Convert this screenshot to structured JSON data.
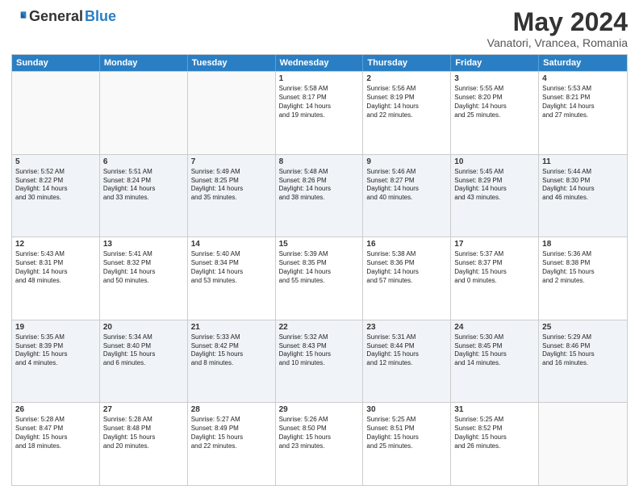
{
  "header": {
    "logo_general": "General",
    "logo_blue": "Blue",
    "month_title": "May 2024",
    "location": "Vanatori, Vrancea, Romania"
  },
  "days_of_week": [
    "Sunday",
    "Monday",
    "Tuesday",
    "Wednesday",
    "Thursday",
    "Friday",
    "Saturday"
  ],
  "rows": [
    {
      "alt": false,
      "cells": [
        {
          "day": "",
          "info": ""
        },
        {
          "day": "",
          "info": ""
        },
        {
          "day": "",
          "info": ""
        },
        {
          "day": "1",
          "info": "Sunrise: 5:58 AM\nSunset: 8:17 PM\nDaylight: 14 hours\nand 19 minutes."
        },
        {
          "day": "2",
          "info": "Sunrise: 5:56 AM\nSunset: 8:19 PM\nDaylight: 14 hours\nand 22 minutes."
        },
        {
          "day": "3",
          "info": "Sunrise: 5:55 AM\nSunset: 8:20 PM\nDaylight: 14 hours\nand 25 minutes."
        },
        {
          "day": "4",
          "info": "Sunrise: 5:53 AM\nSunset: 8:21 PM\nDaylight: 14 hours\nand 27 minutes."
        }
      ]
    },
    {
      "alt": true,
      "cells": [
        {
          "day": "5",
          "info": "Sunrise: 5:52 AM\nSunset: 8:22 PM\nDaylight: 14 hours\nand 30 minutes."
        },
        {
          "day": "6",
          "info": "Sunrise: 5:51 AM\nSunset: 8:24 PM\nDaylight: 14 hours\nand 33 minutes."
        },
        {
          "day": "7",
          "info": "Sunrise: 5:49 AM\nSunset: 8:25 PM\nDaylight: 14 hours\nand 35 minutes."
        },
        {
          "day": "8",
          "info": "Sunrise: 5:48 AM\nSunset: 8:26 PM\nDaylight: 14 hours\nand 38 minutes."
        },
        {
          "day": "9",
          "info": "Sunrise: 5:46 AM\nSunset: 8:27 PM\nDaylight: 14 hours\nand 40 minutes."
        },
        {
          "day": "10",
          "info": "Sunrise: 5:45 AM\nSunset: 8:29 PM\nDaylight: 14 hours\nand 43 minutes."
        },
        {
          "day": "11",
          "info": "Sunrise: 5:44 AM\nSunset: 8:30 PM\nDaylight: 14 hours\nand 46 minutes."
        }
      ]
    },
    {
      "alt": false,
      "cells": [
        {
          "day": "12",
          "info": "Sunrise: 5:43 AM\nSunset: 8:31 PM\nDaylight: 14 hours\nand 48 minutes."
        },
        {
          "day": "13",
          "info": "Sunrise: 5:41 AM\nSunset: 8:32 PM\nDaylight: 14 hours\nand 50 minutes."
        },
        {
          "day": "14",
          "info": "Sunrise: 5:40 AM\nSunset: 8:34 PM\nDaylight: 14 hours\nand 53 minutes."
        },
        {
          "day": "15",
          "info": "Sunrise: 5:39 AM\nSunset: 8:35 PM\nDaylight: 14 hours\nand 55 minutes."
        },
        {
          "day": "16",
          "info": "Sunrise: 5:38 AM\nSunset: 8:36 PM\nDaylight: 14 hours\nand 57 minutes."
        },
        {
          "day": "17",
          "info": "Sunrise: 5:37 AM\nSunset: 8:37 PM\nDaylight: 15 hours\nand 0 minutes."
        },
        {
          "day": "18",
          "info": "Sunrise: 5:36 AM\nSunset: 8:38 PM\nDaylight: 15 hours\nand 2 minutes."
        }
      ]
    },
    {
      "alt": true,
      "cells": [
        {
          "day": "19",
          "info": "Sunrise: 5:35 AM\nSunset: 8:39 PM\nDaylight: 15 hours\nand 4 minutes."
        },
        {
          "day": "20",
          "info": "Sunrise: 5:34 AM\nSunset: 8:40 PM\nDaylight: 15 hours\nand 6 minutes."
        },
        {
          "day": "21",
          "info": "Sunrise: 5:33 AM\nSunset: 8:42 PM\nDaylight: 15 hours\nand 8 minutes."
        },
        {
          "day": "22",
          "info": "Sunrise: 5:32 AM\nSunset: 8:43 PM\nDaylight: 15 hours\nand 10 minutes."
        },
        {
          "day": "23",
          "info": "Sunrise: 5:31 AM\nSunset: 8:44 PM\nDaylight: 15 hours\nand 12 minutes."
        },
        {
          "day": "24",
          "info": "Sunrise: 5:30 AM\nSunset: 8:45 PM\nDaylight: 15 hours\nand 14 minutes."
        },
        {
          "day": "25",
          "info": "Sunrise: 5:29 AM\nSunset: 8:46 PM\nDaylight: 15 hours\nand 16 minutes."
        }
      ]
    },
    {
      "alt": false,
      "cells": [
        {
          "day": "26",
          "info": "Sunrise: 5:28 AM\nSunset: 8:47 PM\nDaylight: 15 hours\nand 18 minutes."
        },
        {
          "day": "27",
          "info": "Sunrise: 5:28 AM\nSunset: 8:48 PM\nDaylight: 15 hours\nand 20 minutes."
        },
        {
          "day": "28",
          "info": "Sunrise: 5:27 AM\nSunset: 8:49 PM\nDaylight: 15 hours\nand 22 minutes."
        },
        {
          "day": "29",
          "info": "Sunrise: 5:26 AM\nSunset: 8:50 PM\nDaylight: 15 hours\nand 23 minutes."
        },
        {
          "day": "30",
          "info": "Sunrise: 5:25 AM\nSunset: 8:51 PM\nDaylight: 15 hours\nand 25 minutes."
        },
        {
          "day": "31",
          "info": "Sunrise: 5:25 AM\nSunset: 8:52 PM\nDaylight: 15 hours\nand 26 minutes."
        },
        {
          "day": "",
          "info": ""
        }
      ]
    }
  ]
}
